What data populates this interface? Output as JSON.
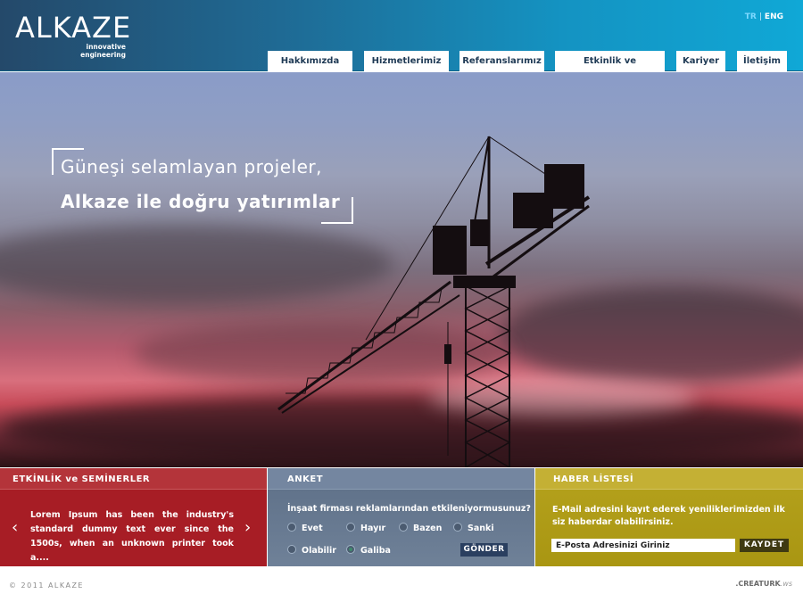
{
  "header": {
    "logo": {
      "brand": "ALKAZE",
      "tagline_1": "innovative",
      "tagline_2": "engineering"
    },
    "lang": {
      "tr": "TR",
      "separator": "|",
      "eng": "ENG"
    },
    "nav": [
      {
        "label": "Hakkımızda"
      },
      {
        "label": "Hizmetlerimiz"
      },
      {
        "label": "Referanslarımız"
      },
      {
        "label": "Etkinlik ve Seminerler"
      },
      {
        "label": "Kariyer"
      },
      {
        "label": "İletişim"
      }
    ]
  },
  "hero": {
    "line1": "Güneşi selamlayan projeler,",
    "line2": "Alkaze ile doğru yatırımlar"
  },
  "events": {
    "title": "ETKİNLİK ve SEMİNERLER",
    "text": "Lorem Ipsum has been the industry's standard dummy text ever since the 1500s, when an unknown printer took a....",
    "prev_icon": "chevron-left-icon",
    "next_icon": "chevron-right-icon"
  },
  "survey": {
    "title": "ANKET",
    "question": "İnşaat firması reklamlarından etkileniyormusunuz?",
    "options": [
      {
        "label": "Evet",
        "checked": false
      },
      {
        "label": "Hayır",
        "checked": false
      },
      {
        "label": "Bazen",
        "checked": false
      },
      {
        "label": "Sanki",
        "checked": false
      },
      {
        "label": "Olabilir",
        "checked": false
      },
      {
        "label": "Galiba",
        "checked": true
      }
    ],
    "submit": "GÖNDER"
  },
  "news": {
    "title": "HABER LİSTESİ",
    "text": "E-Mail adresini kayıt ederek yeniliklerimizden ilk siz haberdar olabilirsiniz.",
    "email_value": "E-Posta Adresinizi Giriniz",
    "save": "KAYDET"
  },
  "footer": {
    "copyright": "© 2011 ALKAZE",
    "credit_brand": ".CREATURK",
    "credit_suffix": ".ws"
  },
  "colors": {
    "header_start": "#24496a",
    "header_end": "#10a8d6",
    "events_bg": "#a71d25",
    "survey_bg": "#5d6f87",
    "news_bg": "#b5a21d"
  }
}
